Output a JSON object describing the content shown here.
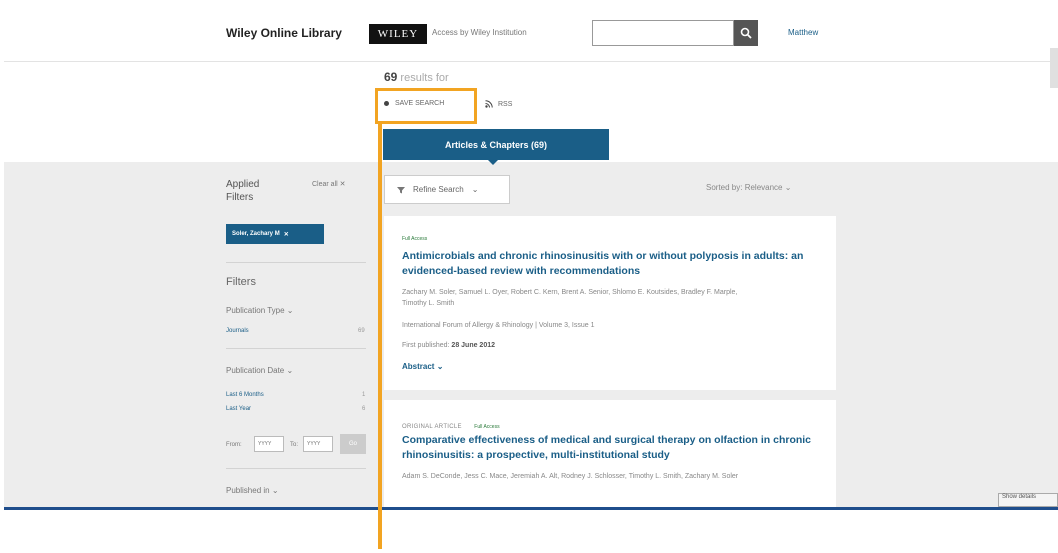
{
  "header": {
    "brand": "Wiley Online Library",
    "logo_text": "WILEY",
    "access_text": "Access by Wiley Institution",
    "search_value": "",
    "user": "Matthew"
  },
  "results": {
    "count": "69",
    "count_suffix": "results for",
    "save_search": "SAVE SEARCH",
    "rss": "RSS",
    "tab_label": "Articles & Chapters (69)"
  },
  "toolbar": {
    "refine": "Refine Search",
    "sorted_by": "Sorted by: Relevance"
  },
  "sidebar": {
    "applied_filters": "Applied Filters",
    "clear_all": "Clear all",
    "chip": "Soler, Zachary M",
    "filters_heading": "Filters",
    "pub_type_label": "Publication Type",
    "pub_type_item": "Journals",
    "pub_type_count": "69",
    "pub_date_label": "Publication Date",
    "date_item1": "Last 6 Months",
    "date_item1_count": "1",
    "date_item2": "Last Year",
    "date_item2_count": "6",
    "from_label": "From:",
    "from_placeholder": "YYYY",
    "to_label": "To:",
    "to_placeholder": "YYYY",
    "go": "Go",
    "published_in": "Published in"
  },
  "articles": [
    {
      "kind": "",
      "access": "Full Access",
      "title": "Antimicrobials and chronic rhinosinusitis with or without polyposis in adults: an evidenced-based review with recommendations",
      "authors": "Zachary M. Soler, Samuel L. Oyer, Robert C. Kern, Brent A. Senior, Shlomo E. Koutsides, Bradley F. Marple, Timothy L. Smith",
      "journal": "International Forum of Allergy & Rhinology | Volume 3, Issue 1",
      "first_published_label": "First published:",
      "first_published": "28 June 2012",
      "abstract": "Abstract"
    },
    {
      "kind": "ORIGINAL ARTICLE",
      "access": "Full Access",
      "title": "Comparative effectiveness of medical and surgical therapy on olfaction in chronic rhinosinusitis: a prospective, multi-institutional study",
      "authors": "Adam S. DeConde, Jess C. Mace, Jeremiah A. Alt, Rodney J. Schlosser, Timothy L. Smith, Zachary M. Soler"
    }
  ],
  "corner_button": "Show details",
  "colors": {
    "primary": "#1a5e87",
    "highlight": "#f2a422",
    "page_gray": "#ededed"
  }
}
